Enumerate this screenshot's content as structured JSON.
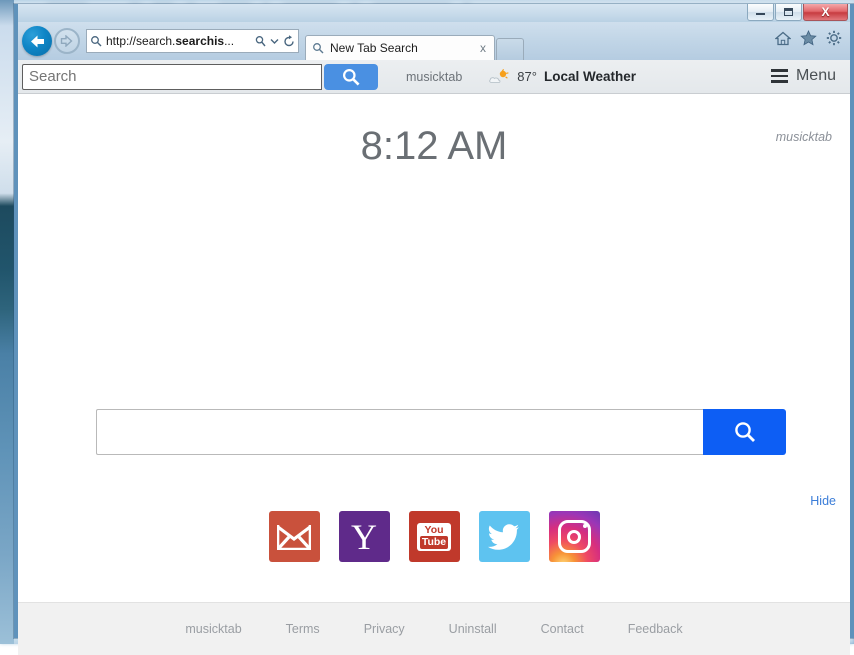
{
  "window": {
    "controls": {
      "minimize_label": "Minimize",
      "restore_label": "Restore",
      "close_label": "X"
    }
  },
  "browser": {
    "back_icon": "back-arrow-icon",
    "forward_icon": "forward-arrow-icon",
    "address": {
      "search_icon": "magnifier-icon",
      "url_prefix": "http://search.",
      "url_bold": "searchis",
      "url_suffix": "...",
      "dropdown_icon": "chevron-down-icon",
      "refresh_icon": "refresh-icon"
    },
    "tab": {
      "favicon": "magnifier-icon",
      "title": "New Tab Search",
      "close_label": "x"
    },
    "tools": {
      "home_icon": "home-icon",
      "favorites_icon": "star-icon",
      "settings_icon": "gear-icon"
    }
  },
  "toolbar": {
    "search_placeholder": "Search",
    "search_value": "",
    "search_button_icon": "magnifier-icon",
    "brand": "musicktab",
    "weather": {
      "icon": "sun-cloud-icon",
      "temperature": "87°",
      "label": "Local Weather"
    },
    "menu": {
      "icon": "hamburger-icon",
      "label": "Menu"
    },
    "accent_color": "#4a90e2"
  },
  "page": {
    "clock": "8:12 AM",
    "watermark": "musicktab",
    "search": {
      "placeholder": "",
      "value": "",
      "button_icon": "magnifier-icon",
      "button_color": "#0d5ef4"
    },
    "hide_label": "Hide",
    "shortcuts": [
      {
        "name": "Gmail",
        "icon": "envelope-icon",
        "color": "#c9513c"
      },
      {
        "name": "Yahoo",
        "icon": "yahoo-y-icon",
        "color": "#5f2a8a",
        "glyph": "Y"
      },
      {
        "name": "YouTube",
        "icon": "youtube-icon",
        "color": "#c0392b",
        "line1": "You",
        "line2": "Tube"
      },
      {
        "name": "Twitter",
        "icon": "twitter-bird-icon",
        "color": "#5ec3f0"
      },
      {
        "name": "Instagram",
        "icon": "instagram-camera-icon",
        "color": "#d62e7f"
      }
    ]
  },
  "footer": {
    "links": [
      "musicktab",
      "Terms",
      "Privacy",
      "Uninstall",
      "Contact",
      "Feedback"
    ]
  }
}
